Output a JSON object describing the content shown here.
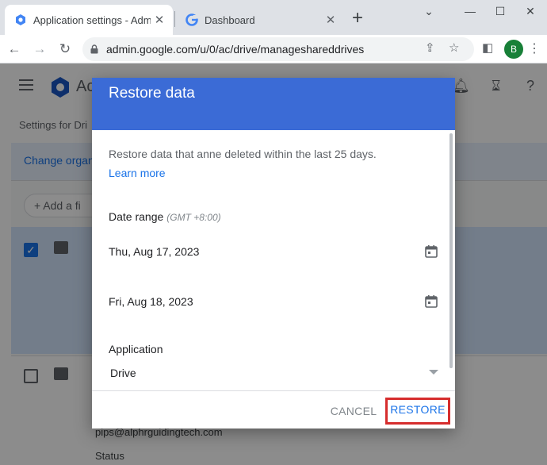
{
  "browser": {
    "tabs": [
      {
        "title": "Application settings - Admin",
        "active": true
      },
      {
        "title": "Dashboard",
        "active": false
      }
    ],
    "url": "admin.google.com/u/0/ac/drive/manageshareddrives",
    "profile_initial": "B",
    "controls": {
      "minimize": "⌄",
      "restore": "—",
      "maximize": "☐",
      "close": "✕"
    }
  },
  "page": {
    "app_name_fragment": "Ac",
    "breadcrumb_fragment": "Settings for Dri",
    "org_link_fragment": "Change organ",
    "add_filter_fragment": "Add a fi",
    "row_email_fragment": "pips@alphrguidingtech.com",
    "row_status_label": "Status"
  },
  "dialog": {
    "title": "Restore data",
    "description": "Restore data that anne deleted within the last 25 days.",
    "learn_more": "Learn more",
    "date_range_label": "Date range",
    "timezone": "(GMT +8:00)",
    "start_date": "Thu, Aug 17, 2023",
    "end_date": "Fri, Aug 18, 2023",
    "application_label": "Application",
    "application_value": "Drive",
    "cancel_label": "CANCEL",
    "restore_label": "RESTORE"
  },
  "colors": {
    "dialog_header": "#3b6bd6",
    "accent": "#1a73e8",
    "highlight_box": "#d62d2d"
  }
}
